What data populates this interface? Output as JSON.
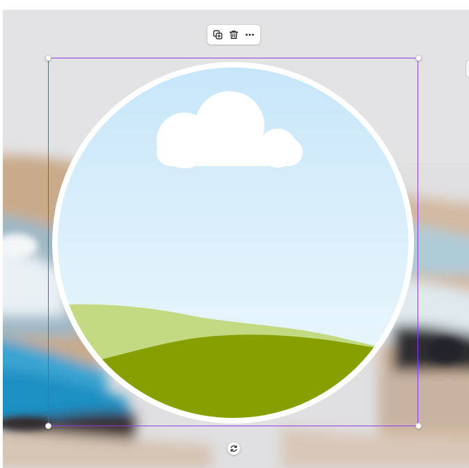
{
  "editor": {
    "accent_color": "#8b3dff",
    "canvas_bg_color": "#e2e3e6"
  },
  "toolbar": {
    "buttons": [
      {
        "name": "duplicate",
        "icon": "duplicate-icon"
      },
      {
        "name": "delete",
        "icon": "trash-icon"
      },
      {
        "name": "more",
        "icon": "more-horizontal-icon"
      }
    ]
  },
  "selection": {
    "element": "circle-frame",
    "handles": [
      "top-left",
      "top-right",
      "bottom-left",
      "bottom-right"
    ],
    "rotate_icon": "rotate-icon"
  },
  "frame_placeholder": {
    "shape": "circle",
    "border_color": "#ffffff",
    "sky_top_color": "#c6e6fa",
    "sky_bottom_color": "#eef8fd",
    "cloud_color": "#ffffff",
    "back_hill_color": "#c4da82",
    "front_hill_color": "#87a000"
  }
}
